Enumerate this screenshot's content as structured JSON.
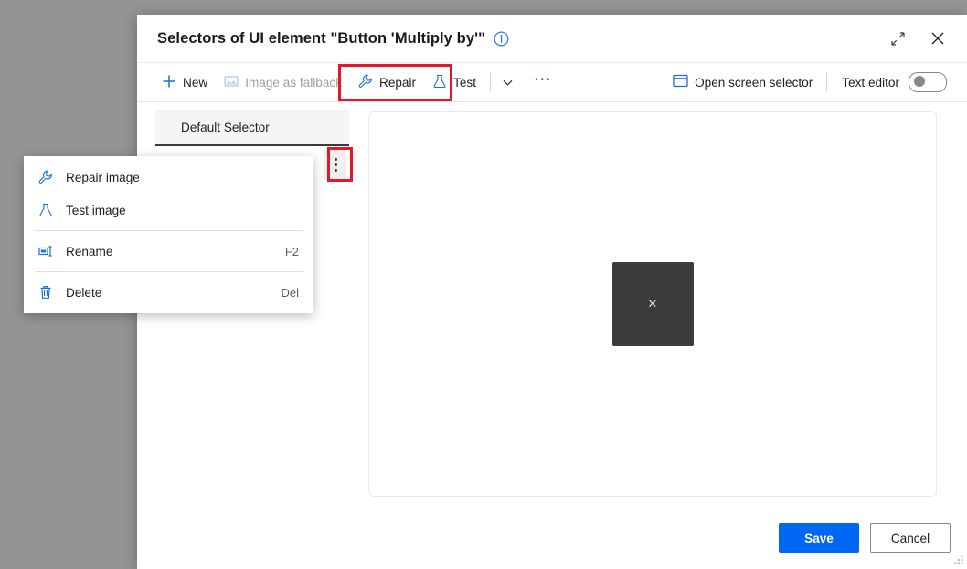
{
  "dialog": {
    "title": "Selectors of UI element \"Button 'Multiply by'\"",
    "info_icon": "info-circle-icon",
    "expand_icon": "expand-diagonal-icon",
    "close_icon": "close-icon"
  },
  "toolbar": {
    "new_label": "New",
    "new_icon": "plus-icon",
    "fallback_label": "Image as fallback",
    "fallback_icon": "image-icon",
    "repair_label": "Repair",
    "repair_icon": "wrench-icon",
    "test_label": "Test",
    "test_icon": "flask-icon",
    "chevron_icon": "chevron-down-icon",
    "overflow_label": "⋯",
    "overflow_icon": "more-horizontal-icon",
    "screen_selector_label": "Open screen selector",
    "screen_selector_icon": "window-icon",
    "text_editor_label": "Text editor",
    "text_editor_state": "off"
  },
  "selectors_list": {
    "items": [
      {
        "label": "Default Selector",
        "selected": true
      }
    ],
    "row_menu_icon": "more-vertical-icon"
  },
  "context_menu": {
    "items": [
      {
        "label": "Repair image",
        "icon": "wrench-icon",
        "shortcut": "",
        "separator_after": false
      },
      {
        "label": "Test image",
        "icon": "flask-icon",
        "shortcut": "",
        "separator_after": true
      },
      {
        "label": "Rename",
        "icon": "rename-icon",
        "shortcut": "F2",
        "separator_after": true
      },
      {
        "label": "Delete",
        "icon": "trash-icon",
        "shortcut": "Del",
        "separator_after": false
      }
    ]
  },
  "preview": {
    "placeholder_icon": "broken-image-icon",
    "placeholder_glyph": "✕"
  },
  "footer": {
    "save_label": "Save",
    "cancel_label": "Cancel"
  },
  "colors": {
    "accent_blue": "#0067f5",
    "icon_blue": "#0f6cbd",
    "highlight_red": "#e8142a",
    "page_background": "#949494"
  }
}
